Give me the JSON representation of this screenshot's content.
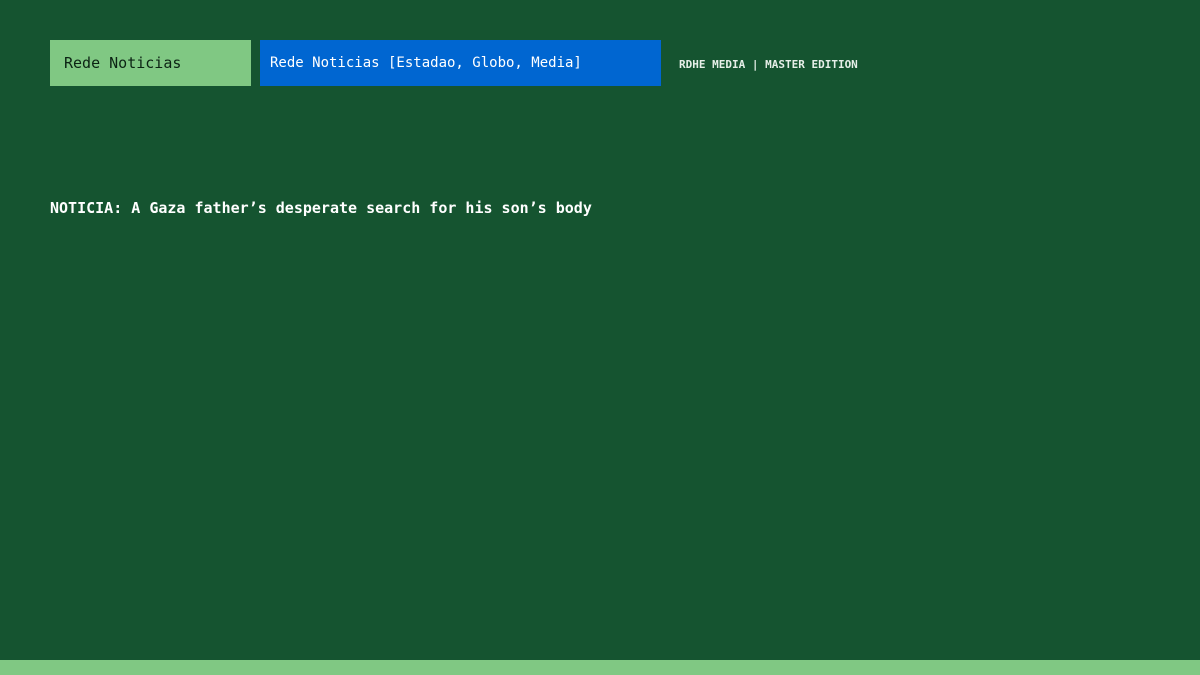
{
  "header": {
    "home_tab_label": "Rede Noticias",
    "sources_tab_label": "Rede Noticias [Estadao, Globo, Media]",
    "brand_text": "RDHE MEDIA | MASTER EDITION"
  },
  "main": {
    "headline": "NOTICIA: A Gaza father’s desperate search for his son’s body"
  },
  "colors": {
    "background": "#155430",
    "accent_green": "#80c883",
    "accent_blue": "#0066d1",
    "text_light": "#ffffff"
  }
}
